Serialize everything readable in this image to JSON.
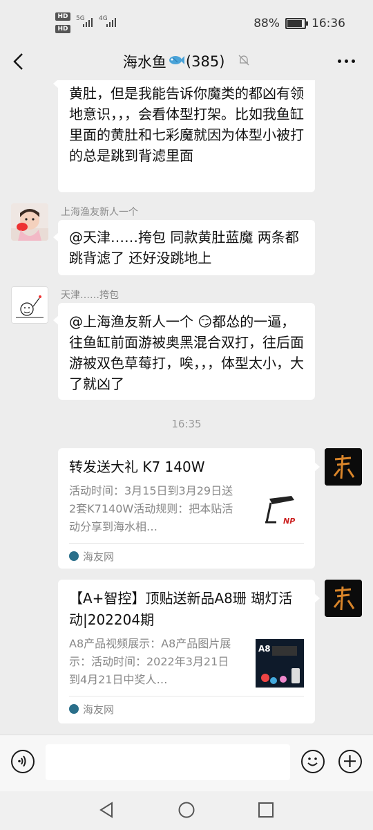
{
  "status_bar": {
    "left_badges": [
      "HD",
      "HD"
    ],
    "network": [
      "5G",
      "4G"
    ],
    "battery": "88%",
    "battery_level": 0.88,
    "time": "16:36"
  },
  "header": {
    "title": "海水鱼",
    "member_count": "(385)",
    "icons": [
      "back-arrow-icon",
      "fish-emoji-icon",
      "mute-bell-icon",
      "more-dots-icon"
    ]
  },
  "messages": [
    {
      "type": "text",
      "sender": "",
      "text": "黄肚，但是我能告诉你魔类的都凶有领地意识，，，会看体型打架。比如我鱼缸里面的黄肚和七彩魔就因为体型小被打的总是跳到背滤里面"
    },
    {
      "type": "text",
      "sender": "上海渔友新人一个",
      "text": "@天津……挎包  同款黄肚蓝魔  两条都跳背滤了  还好没跳地上"
    },
    {
      "type": "text",
      "sender": "天津……挎包",
      "text": "@上海渔友新人一个 😏都怂的一逼，往鱼缸前面游被奥黑混合双打，往后面游被双色草莓打，唉，，，体型太小，大了就凶了"
    }
  ],
  "timestamp": "16:35",
  "cards": [
    {
      "title": "转发送大礼  K7 140W",
      "desc": "活动时间：3月15日到3月29日送2套K7140W活动规则：把本贴活动分享到海水相…",
      "source": "海友网",
      "thumb_label": "NP"
    },
    {
      "title": "【A+智控】顶贴送新品A8珊 瑚灯活动|202204期",
      "desc": "A8产品视频展示：A8产品图片展示：活动时间：2022年3月21日到4月21日中奖人…",
      "source": "海友网",
      "thumb_label": "A8"
    }
  ],
  "input_bar": {
    "placeholder": "",
    "icons": [
      "voice-icon",
      "emoji-icon",
      "plus-icon"
    ]
  },
  "nav_bar": {
    "icons": [
      "back-triangle-icon",
      "home-circle-icon",
      "recents-square-icon"
    ]
  },
  "colors": {
    "background": "#ededed",
    "bubble": "#ffffff",
    "meta_text": "#888888",
    "accent_fish": "#4aa3d8"
  }
}
